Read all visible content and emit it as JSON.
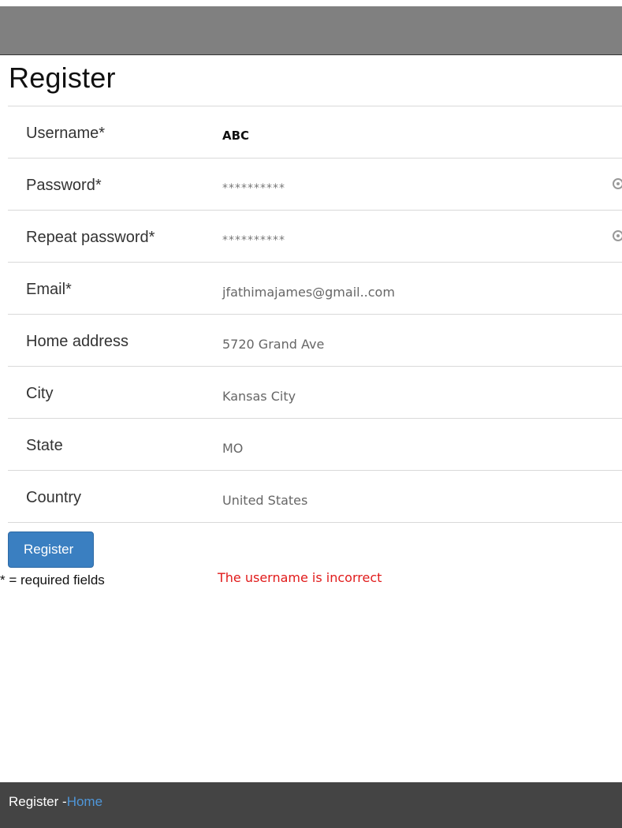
{
  "header": {
    "title": "Register"
  },
  "form": {
    "rows": [
      {
        "label": "Username*",
        "value": "ABC"
      },
      {
        "label": "Password*",
        "value": "**********"
      },
      {
        "label": "Repeat password*",
        "value": "**********"
      },
      {
        "label": "Email*",
        "value": "jfathimajames@gmail..com"
      },
      {
        "label": "Home address",
        "value": "5720 Grand Ave"
      },
      {
        "label": "City",
        "value": "Kansas City"
      },
      {
        "label": "State",
        "value": "MO"
      },
      {
        "label": "Country",
        "value": "United States"
      }
    ],
    "submit_label": "Register",
    "required_note": "* = required fields",
    "error_message": "The username is incorrect"
  },
  "footer": {
    "text": "Register -",
    "link": "Home"
  },
  "icons": {
    "password_toggle": "eye-icon"
  },
  "colors": {
    "button": "#3a7fc1",
    "error": "#e11b1b",
    "footer_bg": "#444444",
    "footer_link": "#4f96d8"
  }
}
